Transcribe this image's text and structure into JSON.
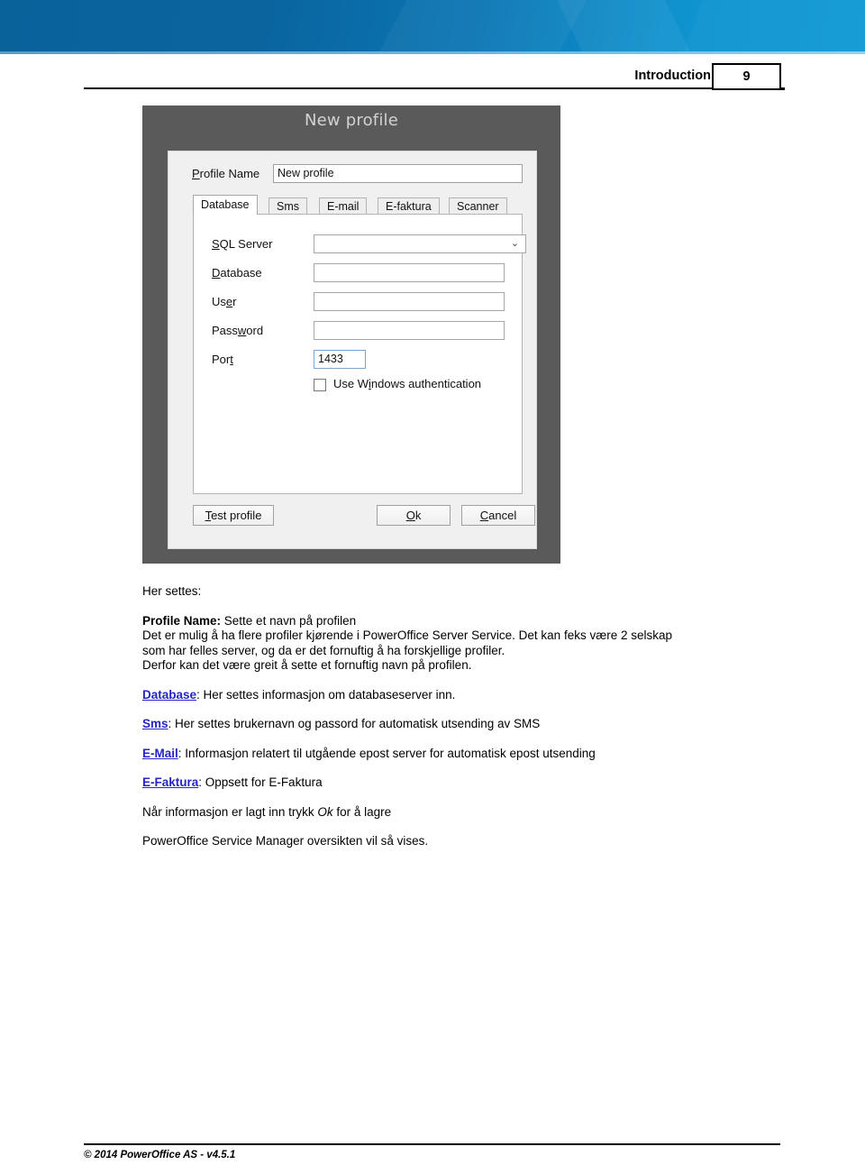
{
  "header": {
    "chapter": "Introduction",
    "page_number": "9"
  },
  "figure": {
    "dialog": {
      "title": "New profile",
      "profile_name_label": "Profile Name",
      "profile_name_value": "New profile",
      "tabs": [
        {
          "label": "Database",
          "active": true
        },
        {
          "label": "Sms",
          "active": false
        },
        {
          "label": "E-mail",
          "active": false
        },
        {
          "label": "E-faktura",
          "active": false
        },
        {
          "label": "Scanner",
          "active": false
        }
      ],
      "fields": [
        {
          "label": "SQL Server",
          "value": "",
          "type": "combobox"
        },
        {
          "label": "Database",
          "value": "",
          "type": "text"
        },
        {
          "label": "User",
          "value": "",
          "type": "text"
        },
        {
          "label": "Password",
          "value": "",
          "type": "text"
        },
        {
          "label": "Port",
          "value": "1433",
          "type": "text-small"
        }
      ],
      "checkbox": {
        "label": "Use Windows authentication",
        "checked": false
      },
      "buttons": {
        "test": "Test profile",
        "ok": "Ok",
        "cancel": "Cancel"
      },
      "chevron": "⌄"
    }
  },
  "content": {
    "intro": "Her settes:",
    "profile_name": {
      "term": "Profile Name:",
      "desc": " Sette et navn på profilen",
      "line2": "Det er mulig å ha flere profiler kjørende i PowerOffice Server Service. Det kan feks være 2 selskap",
      "line3": "som har felles server, og da er det fornuftig å ha forskjellige profiler.",
      "line4": "Derfor kan det være greit å sette et fornuftig navn på profilen."
    },
    "database": {
      "link": "Database",
      "desc": ": Her settes informasjon om databaseserver inn."
    },
    "sms": {
      "link": "Sms",
      "desc": ": Her settes brukernavn og passord for automatisk utsending av SMS"
    },
    "email": {
      "link": "E-Mail",
      "desc": ": Informasjon relatert til utgående epost server for automatisk epost utsending"
    },
    "efaktura": {
      "link": "E-Faktura",
      "desc": ": Oppsett for E-Faktura"
    },
    "save_note_before": "Når informasjon er lagt inn trykk ",
    "save_note_em": "Ok",
    "save_note_after": " for å lagre",
    "closing": "PowerOffice Service Manager oversikten vil så vises."
  },
  "footer": {
    "copyright": "© 2014 PowerOffice AS - v4.5.1"
  },
  "colors": {
    "banner_dark": "#0a629b",
    "banner_light": "#119ad6",
    "dialog_frame": "#5a5a5a",
    "dialog_body": "#f0f0f0",
    "link": "#2424c8",
    "port_focus_border": "#7ba7cf"
  }
}
